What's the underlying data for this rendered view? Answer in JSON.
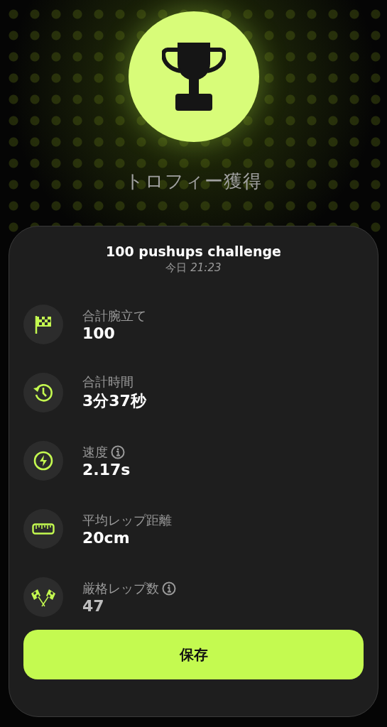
{
  "header": {
    "title": "トロフィー獲得"
  },
  "card": {
    "title": "100 pushups challenge",
    "subtitle": "今日 *21:23*",
    "stats": [
      {
        "kind": "finish",
        "label": "合計腕立て",
        "value": "100",
        "info": false
      },
      {
        "kind": "time",
        "label": "合計時間",
        "value": "3分37秒",
        "info": false
      },
      {
        "kind": "speed",
        "label": "速度",
        "value": "2.17s",
        "info": true
      },
      {
        "kind": "distance",
        "label": "平均レップ距離",
        "value": "20cm",
        "info": false
      },
      {
        "kind": "strict",
        "label": "厳格レップ数",
        "value": "47",
        "info": true
      }
    ],
    "button": "保存"
  }
}
